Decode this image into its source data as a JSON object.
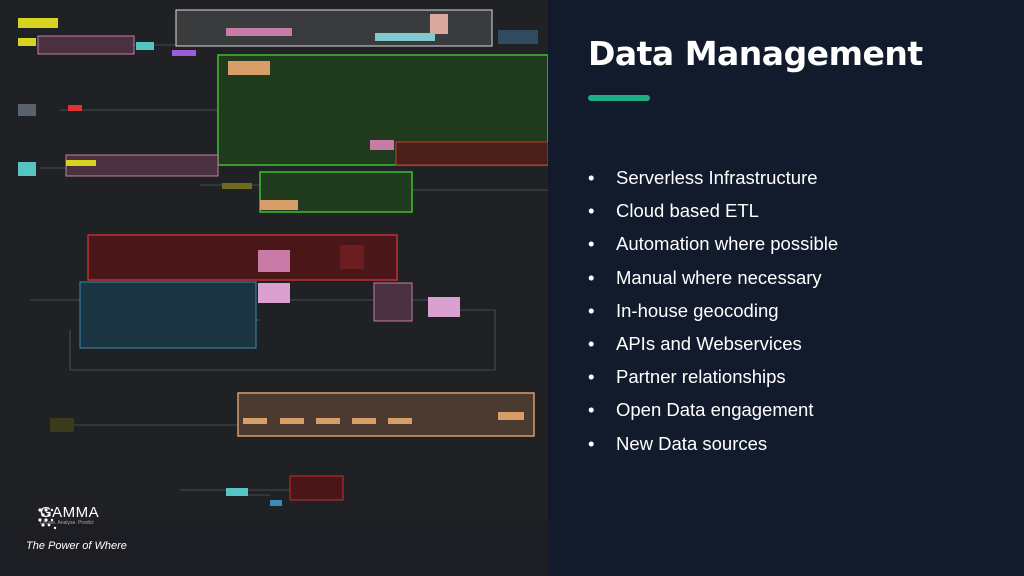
{
  "slide": {
    "title": "Data Management",
    "accent_color": "#1fae84",
    "bullets": [
      "Serverless Infrastructure",
      "Cloud based ETL",
      "Automation where possible",
      "Manual where necessary",
      "In-house geocoding",
      "APIs and Webservices",
      "Partner relationships",
      "Open Data engagement",
      "New Data sources"
    ],
    "bullet_glyph": "•"
  },
  "branding": {
    "logo_name": "GAMMA",
    "logo_tagline": "Locate. Analyse. Predict",
    "slogan": "The Power of Where"
  },
  "workflow_screenshot": {
    "icon": "node-graph-workflow"
  }
}
